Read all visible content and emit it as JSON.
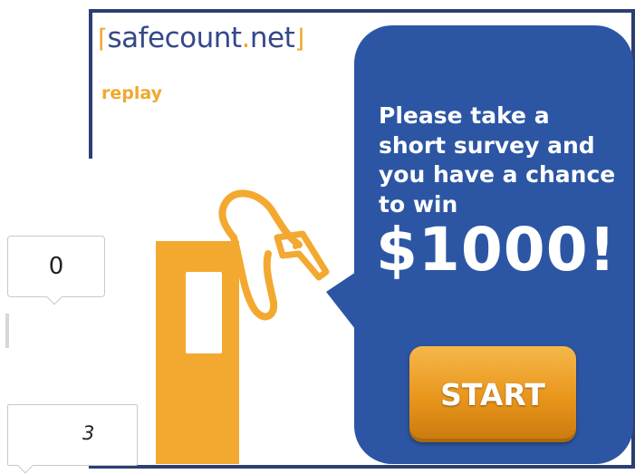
{
  "ad": {
    "brand_prefix": "safecount",
    "brand_dot": ".",
    "brand_suffix": "net",
    "replay_label": "replay",
    "headline": "Please take a short survey and you have a chance to win",
    "prize": "$1000!",
    "start_label": "START"
  },
  "share": {
    "count": "0",
    "comment_count": "3"
  },
  "colors": {
    "brand_blue": "#2c56a4",
    "accent_orange": "#f3a930",
    "frame_navy": "#2b3f73"
  }
}
